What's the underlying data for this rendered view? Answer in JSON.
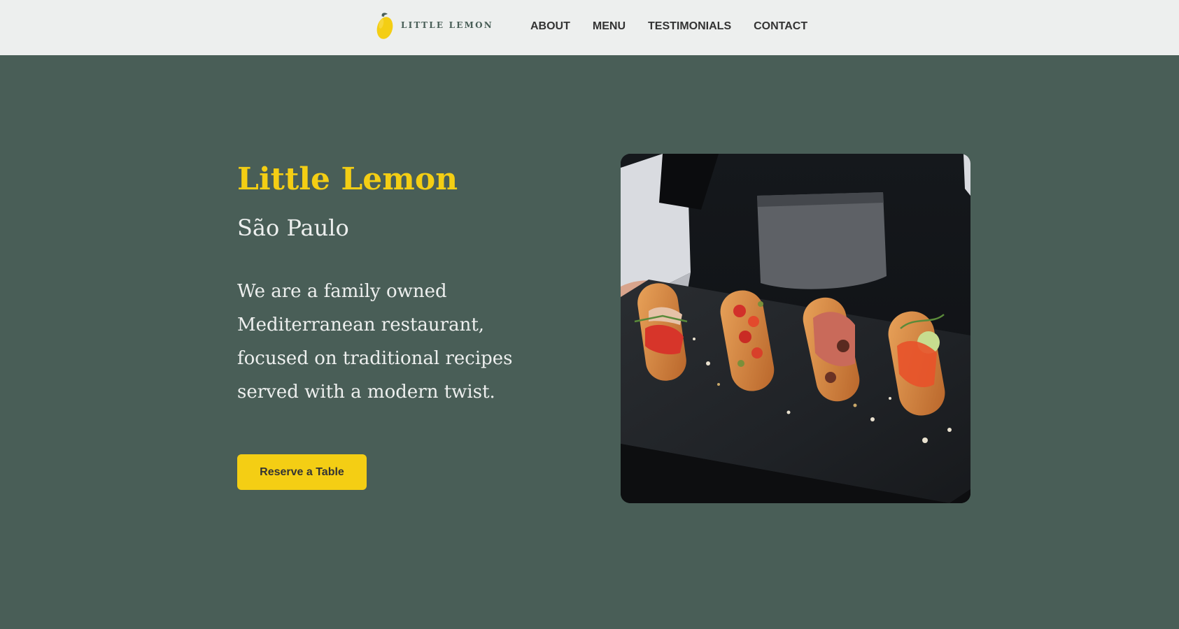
{
  "page": {
    "background_color": "#495e57"
  },
  "header": {
    "background_color": "#edefee",
    "logo": {
      "text": "LITTLE LEMON",
      "icon": "lemon-icon",
      "icon_color": "#f4ce14"
    },
    "nav": [
      {
        "label": "ABOUT"
      },
      {
        "label": "MENU"
      },
      {
        "label": "TESTIMONIALS"
      },
      {
        "label": "CONTACT"
      }
    ]
  },
  "hero": {
    "title": "Little Lemon",
    "subtitle": "São Paulo",
    "description": "We are a family owned Mediterranean restaurant, focused on traditional recipes served with a modern twist.",
    "cta_label": "Reserve a Table",
    "image": {
      "subject": "food-photo",
      "alt": "Server holding slate board with eclairs topped with vegetables and prosciutto"
    },
    "accent_color": "#f4ce14",
    "text_color": "#edefee"
  }
}
